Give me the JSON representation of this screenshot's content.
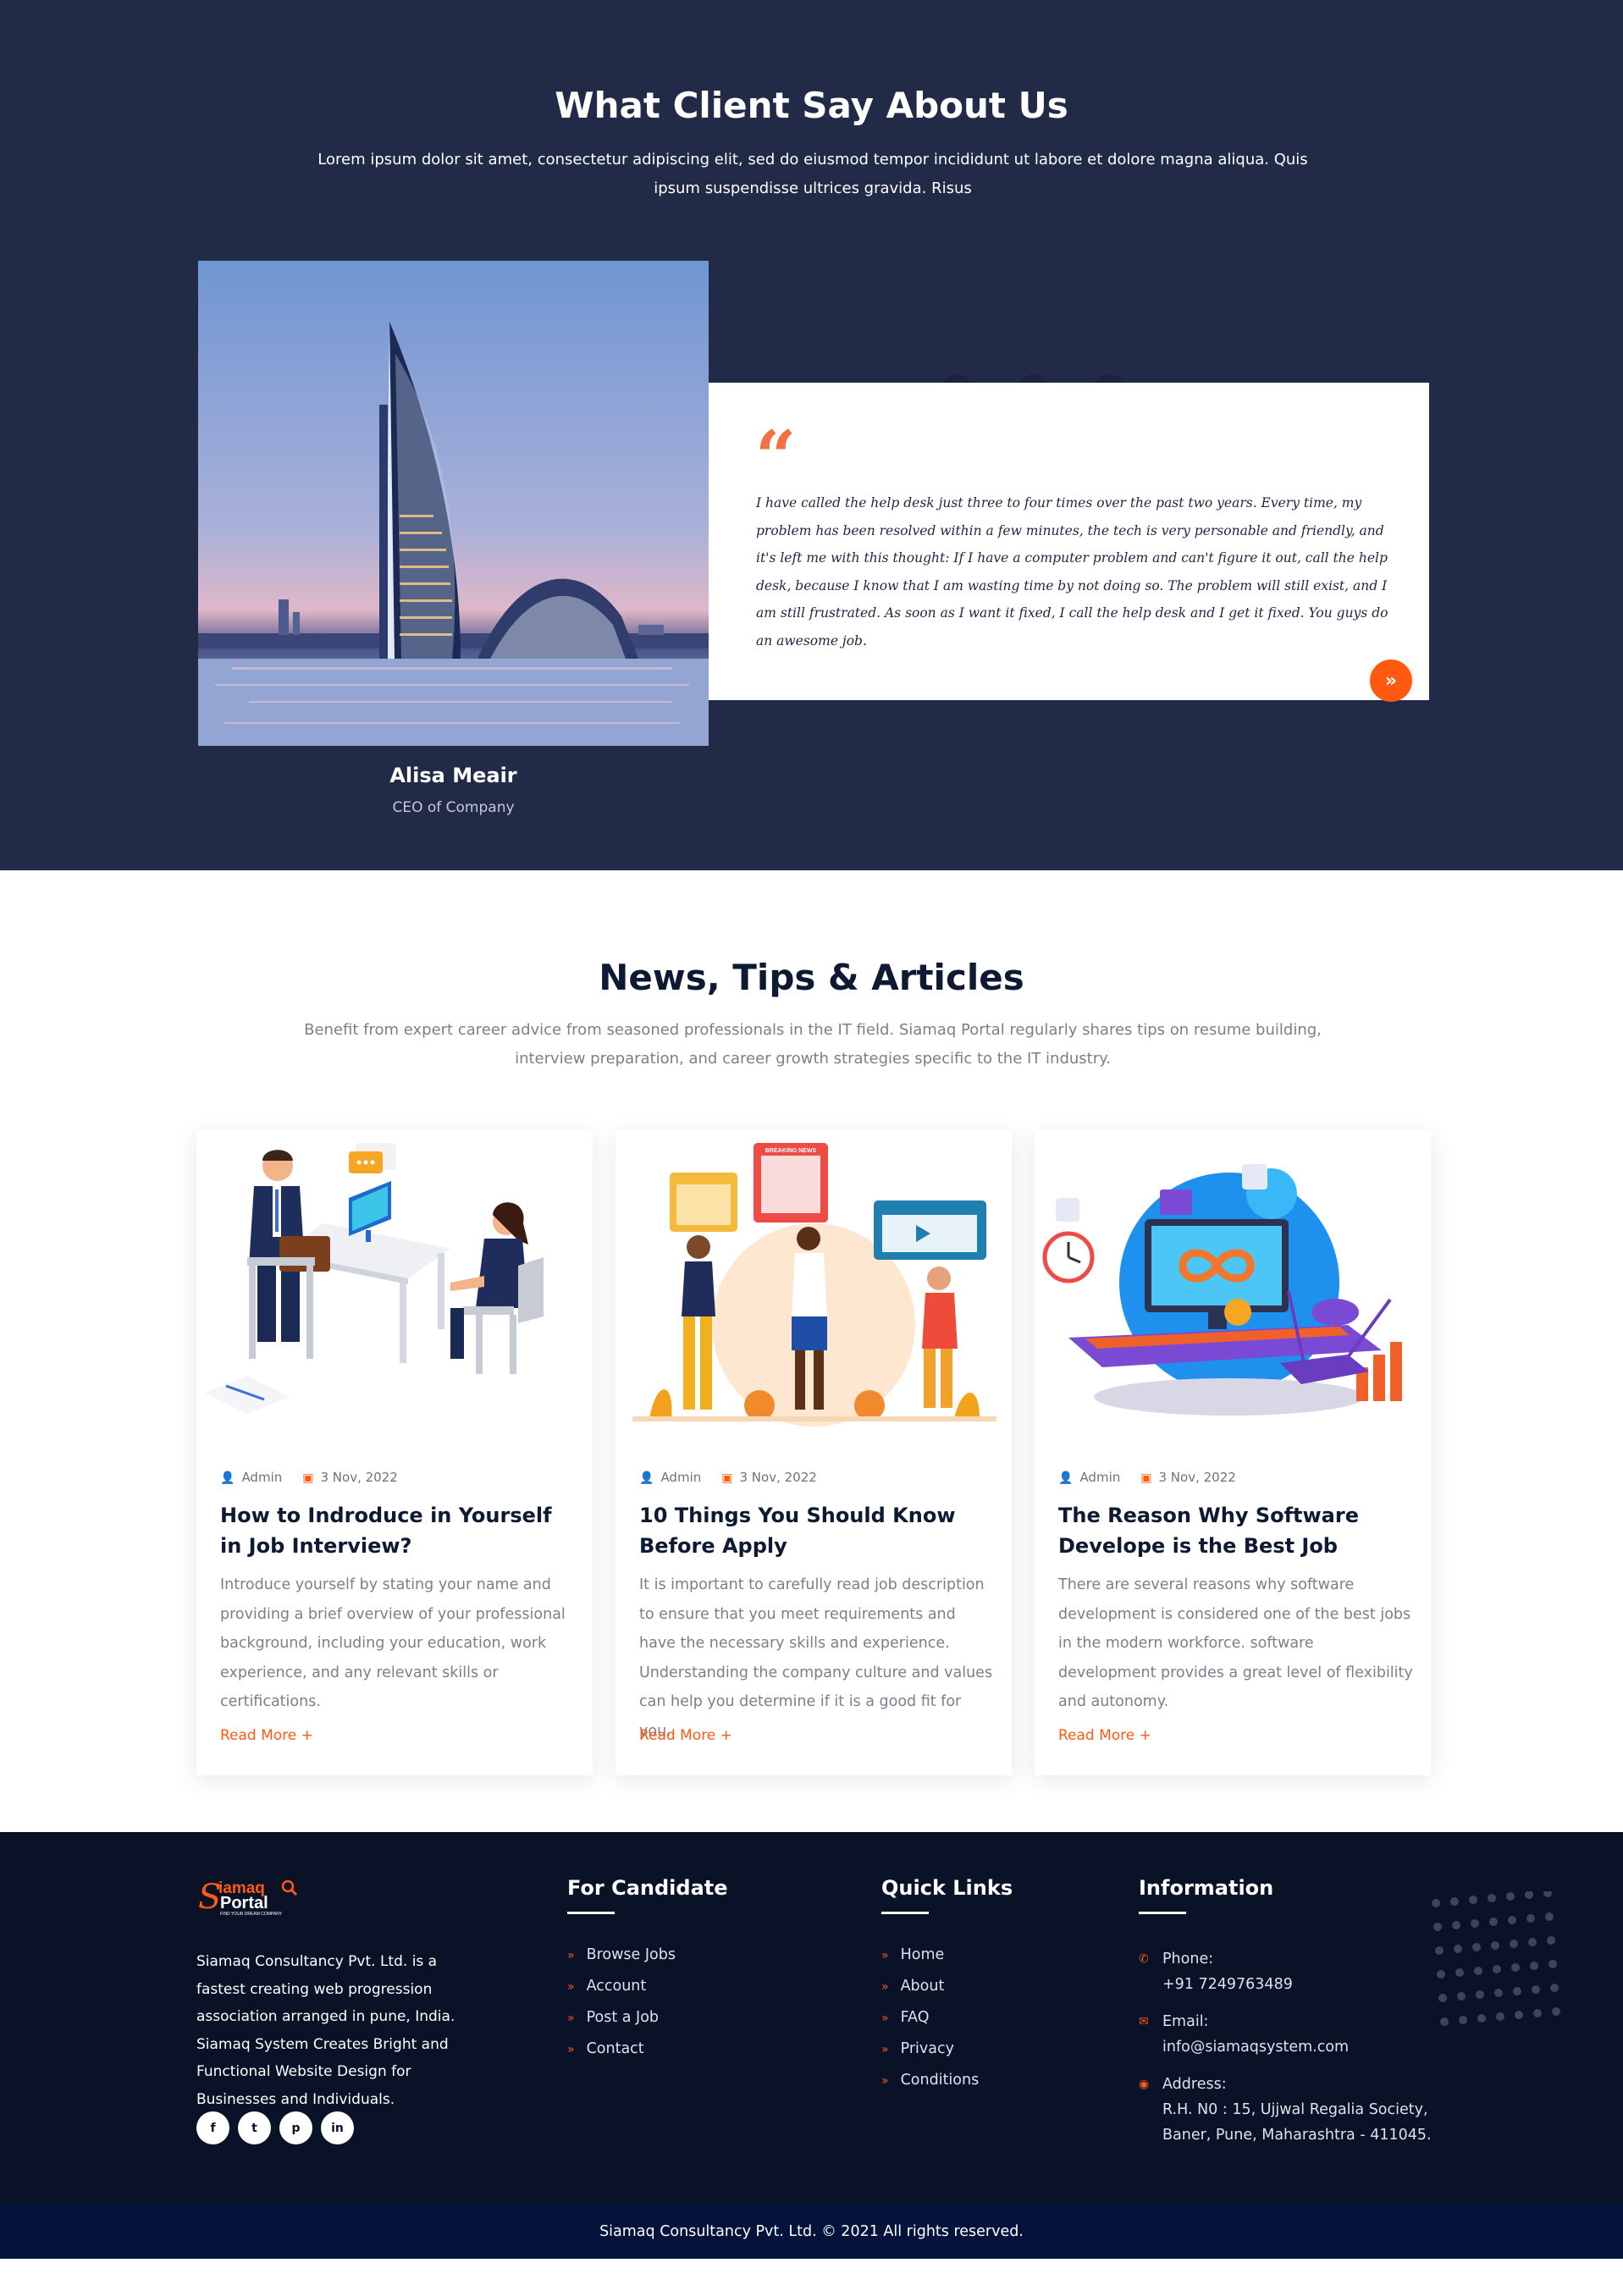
{
  "testimonials": {
    "title": "What Client Say About Us",
    "subtitle": "Lorem ipsum dolor sit amet, consectetur adipiscing elit, sed do eiusmod tempor incididunt ut labore et dolore magna aliqua. Quis ipsum suspendisse ultrices gravida. Risus",
    "quote_mark": "“",
    "quote": "I have called the help desk just three to four times over the past two years. Every time, my problem has been resolved within a few minutes, the tech is very personable and friendly, and it's left me with this thought: If I have a computer problem and can't figure it out, call the help desk, because I know that I am wasting time by not doing so. The problem will still exist, and I am still frustrated. As soon as I want it fixed, I call the help desk and I get it fixed. You guys do an awesome job.",
    "author_name": "Alisa Meair",
    "author_role": "CEO of Company",
    "next_icon": "»"
  },
  "news": {
    "title": "News, Tips & Articles",
    "subtitle": "Benefit from expert career advice from seasoned professionals in the IT field. Siamaq Portal regularly shares tips on resume building, interview preparation, and career growth strategies specific to the IT industry.",
    "posts": [
      {
        "author": "Admin",
        "date": "3 Nov, 2022",
        "title": "How to Indroduce in Yourself in Job Interview?",
        "excerpt": "Introduce yourself by stating your name and providing a brief overview of your professional background, including your education, work experience, and any relevant skills or certifications.",
        "read_more": "Read More +"
      },
      {
        "author": "Admin",
        "date": "3 Nov, 2022",
        "title": "10 Things You Should Know Before Apply",
        "excerpt": "It is important to carefully read job description to ensure that you meet requirements and have the necessary skills and experience. Understanding the company culture and values can help you determine if it is a good fit for you.",
        "read_more": "Read More +"
      },
      {
        "author": "Admin",
        "date": "3 Nov, 2022",
        "title": "The Reason Why Software Develope is the Best Job",
        "excerpt": "There are several reasons why software development is considered one of the best jobs in the modern workforce. software development provides a great level of flexibility and autonomy.",
        "read_more": "Read More +"
      }
    ],
    "illustration_labels": {
      "breaking_news": "BREAKING NEWS"
    }
  },
  "footer": {
    "logo_text_top": "iamaq",
    "logo_text_bottom": "Portal",
    "logo_s": "S",
    "logo_tagline": "FIND YOUR DREAM COMPANY",
    "about": "Siamaq Consultancy Pvt. Ltd. is a fastest creating web progression association arranged in pune, India. Siamaq System Creates Bright and Functional Website Design for Businesses and Individuals.",
    "socials": [
      "f",
      "t",
      "p",
      "in"
    ],
    "social_icons": [
      "facebook-icon",
      "twitter-icon",
      "pinterest-icon",
      "linkedin-icon"
    ],
    "candidate": {
      "title": "For Candidate",
      "links": [
        "Browse Jobs",
        "Account",
        "Post a Job",
        "Contact"
      ]
    },
    "quick": {
      "title": "Quick Links",
      "links": [
        "Home",
        "About",
        "FAQ",
        "Privacy",
        "Conditions"
      ]
    },
    "information": {
      "title": "Information",
      "phone_label": "Phone:",
      "phone": "+91 7249763489",
      "email_label": "Email:",
      "email": "info@siamaqsystem.com",
      "address_label": "Address:",
      "address_line1": "R.H. N0 : 15, Ujjwal Regalia Society,",
      "address_line2": "Baner, Pune, Maharashtra - 411045."
    },
    "copyright": "Siamaq Consultancy Pvt. Ltd. © 2021 All rights reserved."
  },
  "colors": {
    "navy": "#212a46",
    "footer": "#0a1228",
    "accent": "#ff5a0f",
    "copyright_bar": "#03133b"
  }
}
